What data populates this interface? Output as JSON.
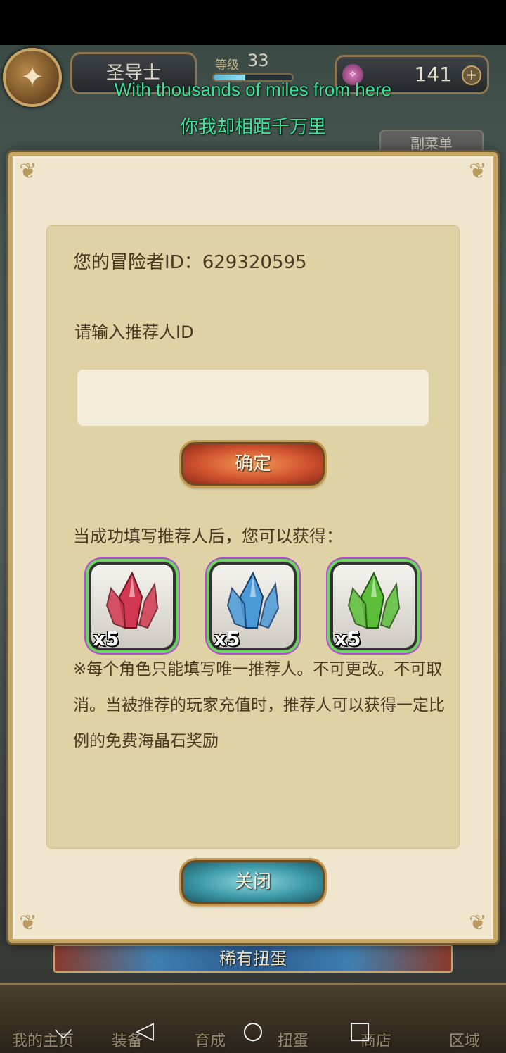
{
  "header": {
    "character_name": "圣导士",
    "level_label": "等级",
    "level_value": "33",
    "level_progress": 0.4,
    "currency_value": "141",
    "plus_symbol": "+",
    "sub_menu_label": "副菜单"
  },
  "subtitles": {
    "english": "With thousands of miles from here",
    "chinese": "你我却相距千万里"
  },
  "dialog": {
    "adventurer_id_line": "您的冒险者ID：629320595",
    "referrer_label": "请输入推荐人ID",
    "referrer_input_value": "",
    "confirm_label": "确定",
    "reward_intro": "当成功填写推荐人后，您可以获得：",
    "rewards": [
      {
        "count": "x5",
        "color": "#d2384f"
      },
      {
        "count": "x5",
        "color": "#4a9ad8"
      },
      {
        "count": "x5",
        "color": "#5bbf3a"
      }
    ],
    "notice": "※每个角色只能填写唯一推荐人。不可更改。不可取消。当被推荐的玩家充值时，推荐人可以获得一定比例的免费海晶石奖励",
    "close_label": "关闭"
  },
  "banner": {
    "label": "稀有扭蛋"
  },
  "bottom_menu": {
    "items": [
      "我的主页",
      "装备",
      "育成",
      "扭蛋",
      "商店",
      "区域"
    ]
  },
  "nav_bar": {
    "down_symbol": "⌵",
    "back_symbol": "◁",
    "home_symbol": "○",
    "recent_symbol": "□"
  }
}
